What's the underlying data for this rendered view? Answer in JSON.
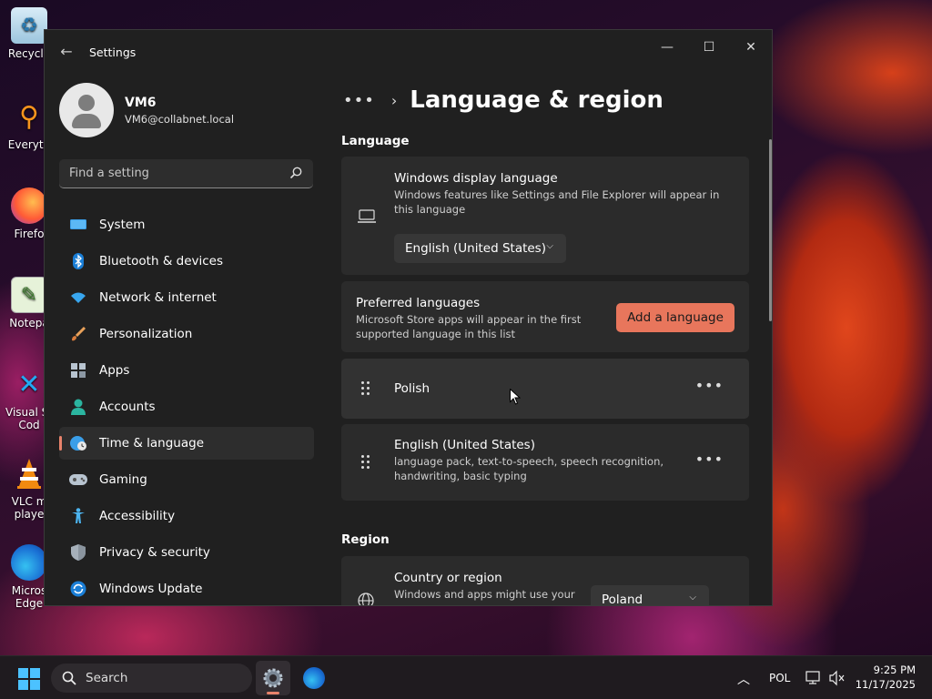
{
  "desktop": {
    "icons": [
      {
        "label": "Recycle",
        "icon": "recycle-bin-icon"
      },
      {
        "label": "Everyth",
        "icon": "everything-search-icon"
      },
      {
        "label": "Firefo",
        "icon": "firefox-icon"
      },
      {
        "label": "Notepa",
        "icon": "notepad-icon"
      },
      {
        "label": "Visual St",
        "label2": "Cod",
        "icon": "vscode-icon"
      },
      {
        "label": "VLC m",
        "label2": "playe",
        "icon": "vlc-icon"
      },
      {
        "label": "Micros",
        "label2": "Edge",
        "icon": "edge-icon"
      }
    ]
  },
  "window": {
    "title": "Settings",
    "controls": {
      "minimize": "—",
      "maximize": "☐",
      "close": "✕"
    }
  },
  "profile": {
    "name": "VM6",
    "email": "VM6@collabnet.local"
  },
  "search": {
    "placeholder": "Find a setting"
  },
  "sidebar": {
    "items": [
      {
        "label": "System",
        "icon": "system-icon",
        "active": false
      },
      {
        "label": "Bluetooth & devices",
        "icon": "bluetooth-icon",
        "active": false
      },
      {
        "label": "Network & internet",
        "icon": "network-icon",
        "active": false
      },
      {
        "label": "Personalization",
        "icon": "brush-icon",
        "active": false
      },
      {
        "label": "Apps",
        "icon": "apps-icon",
        "active": false
      },
      {
        "label": "Accounts",
        "icon": "accounts-icon",
        "active": false
      },
      {
        "label": "Time & language",
        "icon": "globe-clock-icon",
        "active": true
      },
      {
        "label": "Gaming",
        "icon": "gamepad-icon",
        "active": false
      },
      {
        "label": "Accessibility",
        "icon": "accessibility-icon",
        "active": false
      },
      {
        "label": "Privacy & security",
        "icon": "shield-icon",
        "active": false
      },
      {
        "label": "Windows Update",
        "icon": "update-icon",
        "active": false
      }
    ],
    "accent_color": "#e8836b"
  },
  "breadcrumb": {
    "dots": "•••",
    "title": "Language & region"
  },
  "language_section": {
    "title": "Language",
    "display_language": {
      "title": "Windows display language",
      "description": "Windows features like Settings and File Explorer will appear in this language",
      "selected": "English (United States)"
    },
    "preferred": {
      "title": "Preferred languages",
      "description": "Microsoft Store apps will appear in the first supported language in this list",
      "add_button": "Add a language"
    },
    "languages": [
      {
        "name": "Polish",
        "features": ""
      },
      {
        "name": "English (United States)",
        "features": "language pack, text-to-speech, speech recognition, handwriting, basic typing"
      }
    ]
  },
  "region_section": {
    "title": "Region",
    "country": {
      "title": "Country or region",
      "description": "Windows and apps might use your",
      "selected": "Poland"
    }
  },
  "taskbar": {
    "search_label": "Search",
    "language_indicator": "POL",
    "time": "9:25 PM",
    "date": "11/17/2025",
    "accent_color": "#4cc2ff"
  }
}
